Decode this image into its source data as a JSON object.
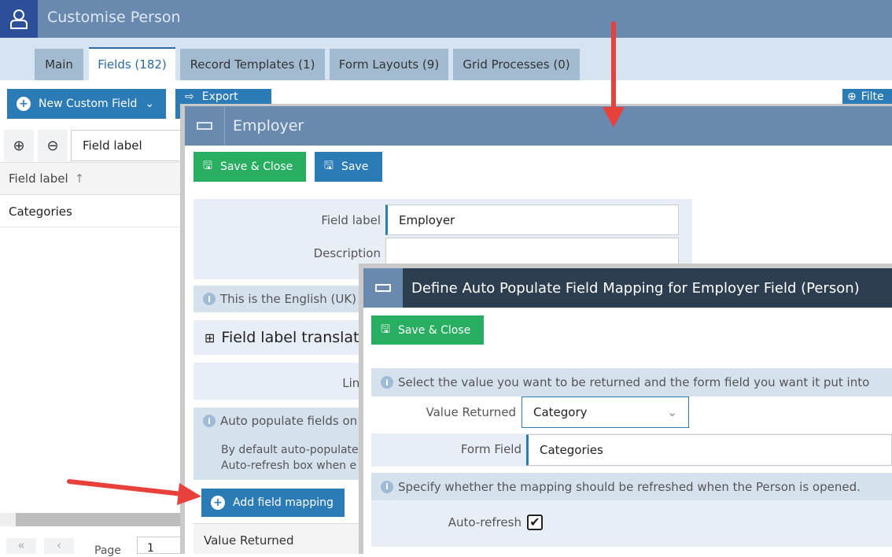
{
  "app": {
    "title": "Customise Person",
    "icon": "person-icon"
  },
  "tabs": [
    {
      "label": "Main"
    },
    {
      "label": "Fields (182)"
    },
    {
      "label": "Record Templates (1)"
    },
    {
      "label": "Form Layouts (9)"
    },
    {
      "label": "Grid Processes (0)"
    }
  ],
  "toolbar": {
    "new_custom_field": "New Custom Field",
    "export": "Export",
    "filter": "Filte"
  },
  "grid": {
    "search_value": "Field label",
    "column": "Field label",
    "rows": [
      "Categories"
    ],
    "pager_label": "Page",
    "page_value": "1"
  },
  "employer_dialog": {
    "title": "Employer",
    "save_close": "Save & Close",
    "save": "Save",
    "field_label_label": "Field label",
    "field_label_value": "Employer",
    "description_label": "Description",
    "description_value": "",
    "info_language": "This is the English (UK) la",
    "translations": "Field label translatio",
    "link_label": "Link",
    "info_auto": "Auto populate fields on y",
    "auto_text_1": "By default auto-populate",
    "auto_text_2": "Auto-refresh box when e",
    "add_mapping": "Add field mapping",
    "mapping_column": "Value Returned"
  },
  "mapping_dialog": {
    "title": "Define Auto Populate Field Mapping for Employer Field (Person)",
    "save_close": "Save & Close",
    "info_select": "Select the value you want to be returned and the form field you want it put into",
    "value_returned_label": "Value Returned",
    "value_returned_value": "Category",
    "form_field_label": "Form Field",
    "form_field_value": "Categories",
    "info_refresh": "Specify whether the mapping should be refreshed when the Person is opened.",
    "auto_refresh_label": "Auto-refresh",
    "auto_refresh_checked": true
  },
  "colors": {
    "header": "#6a89ae",
    "dark_header": "#2d3e50",
    "primary": "#2a7bb6",
    "success": "#27ae60",
    "annotation_arrow": "#e8413c"
  }
}
